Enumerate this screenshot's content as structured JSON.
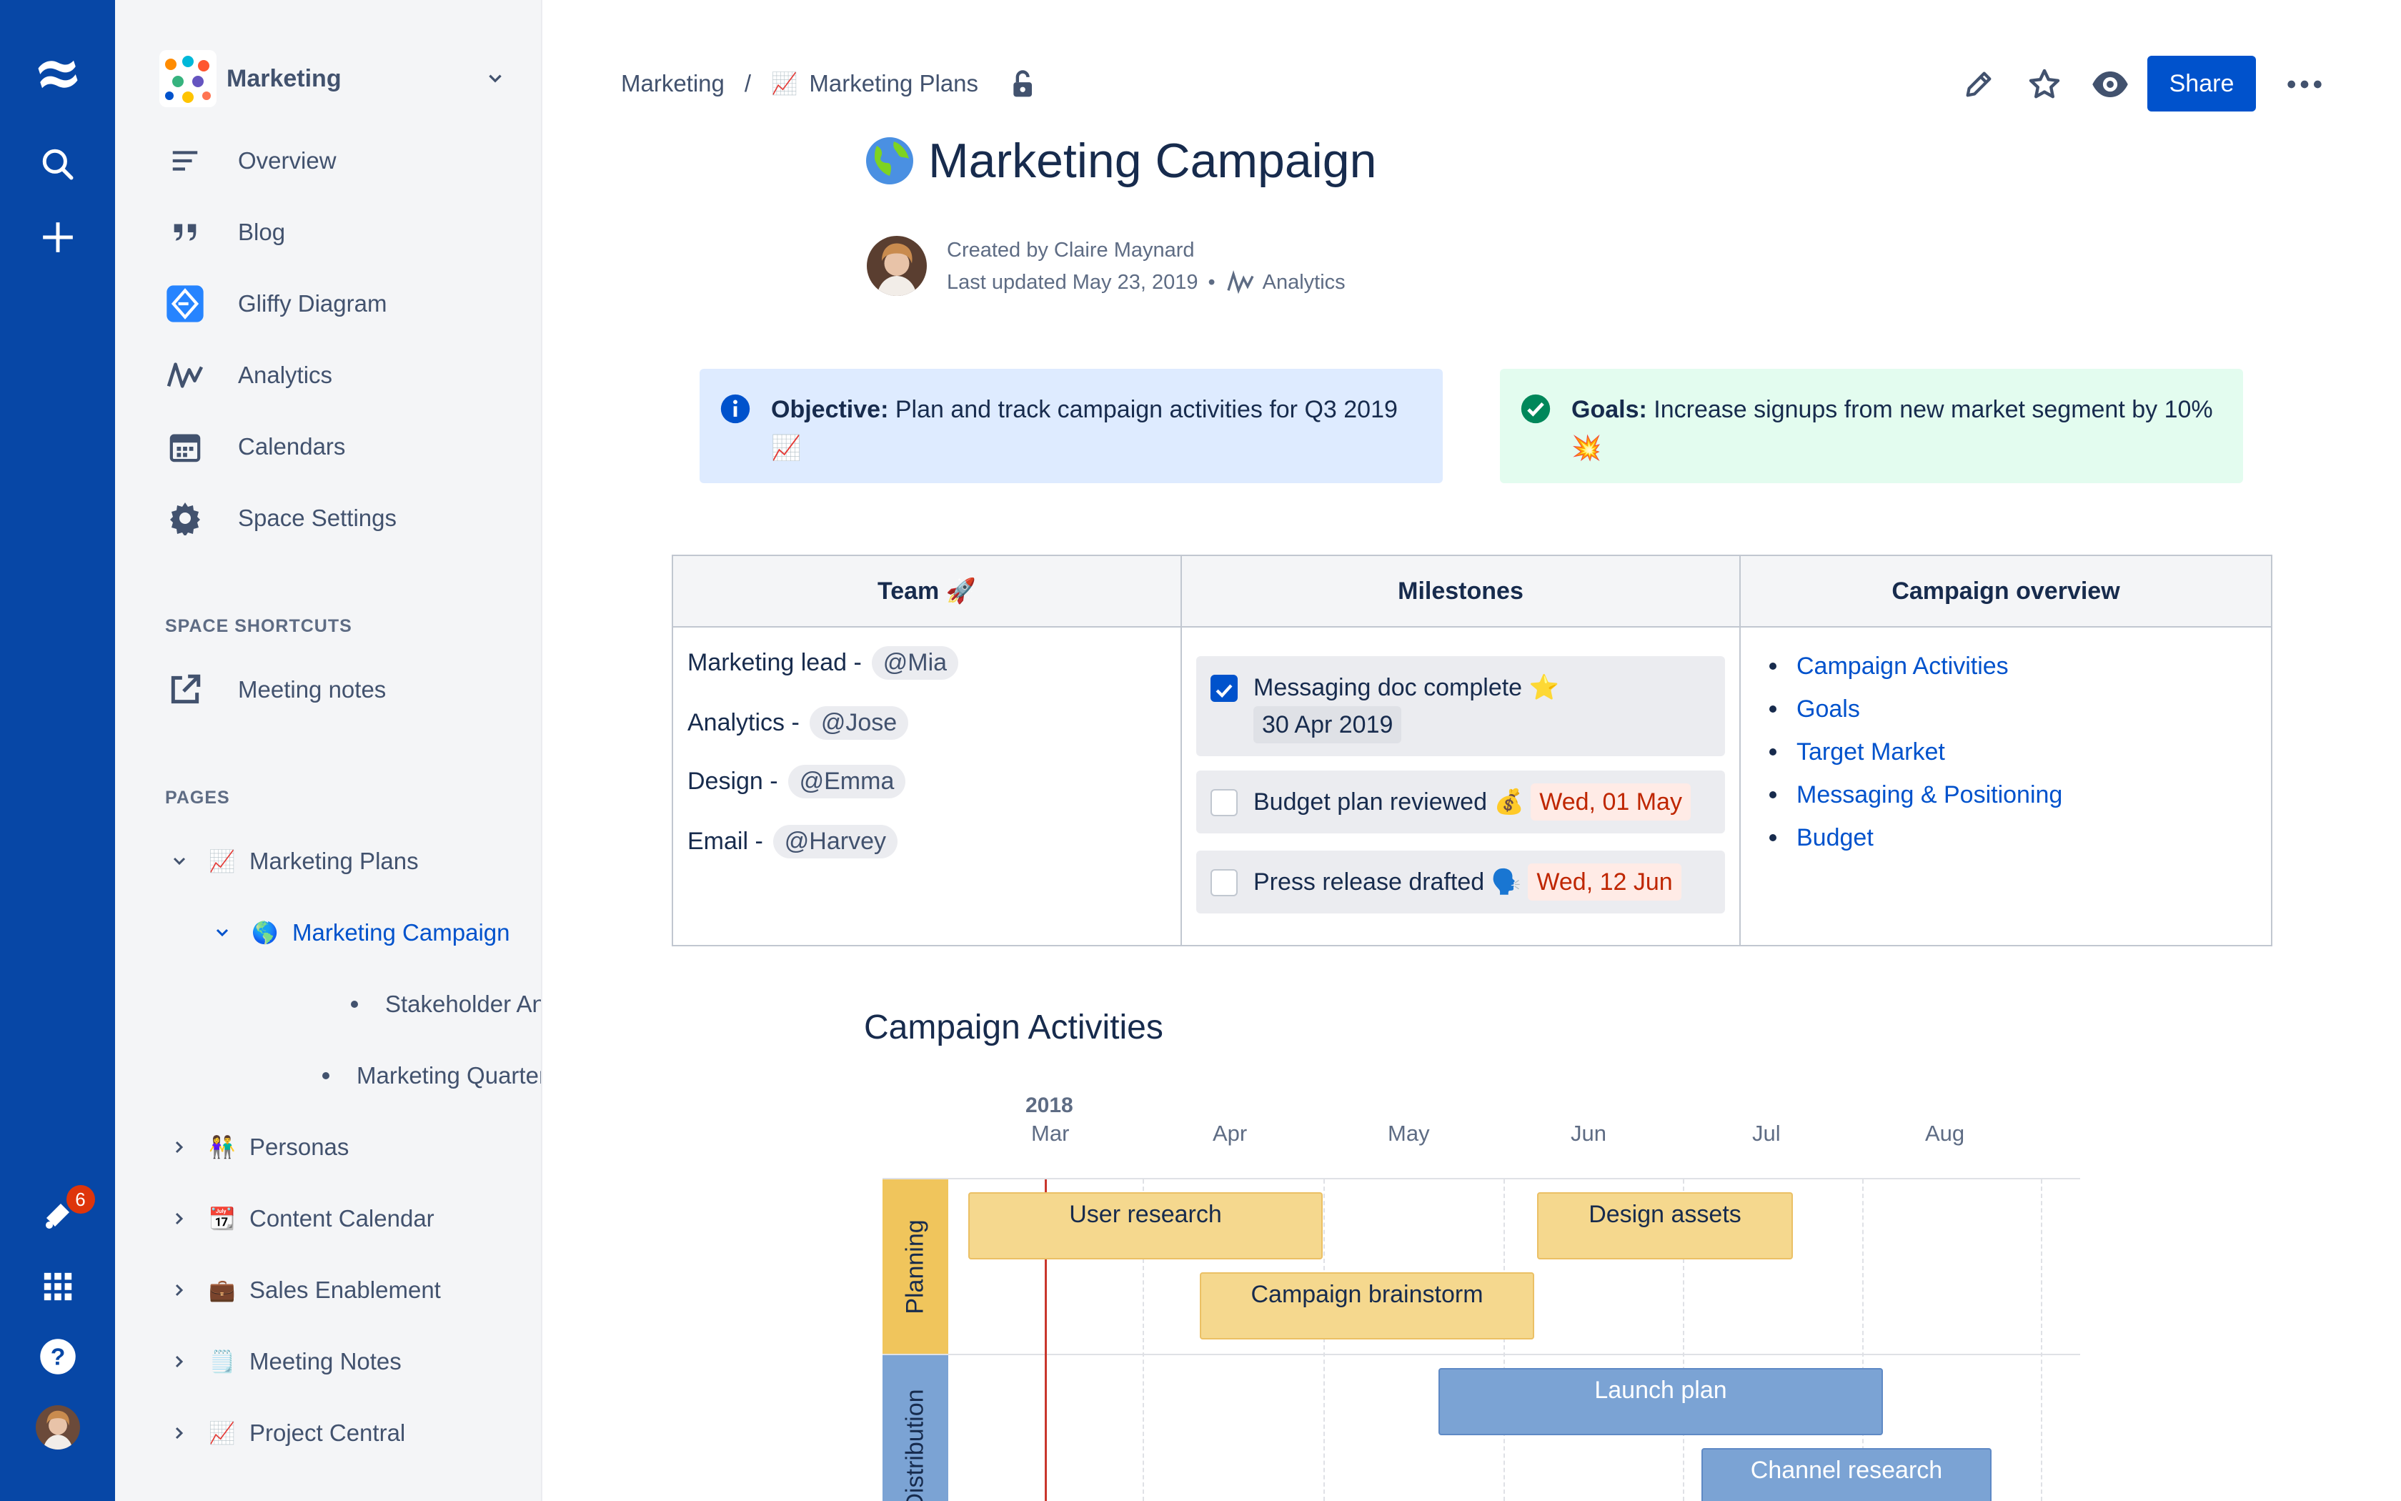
{
  "global_nav": {
    "notifications_count": "6",
    "icons": [
      "confluence-logo-icon",
      "search-icon",
      "create-icon",
      "notifications-icon",
      "app-switcher-icon",
      "help-icon",
      "profile-avatar"
    ]
  },
  "sidebar": {
    "space_name": "Marketing",
    "items": [
      {
        "label": "Overview",
        "icon": "overview-icon"
      },
      {
        "label": "Blog",
        "icon": "quote-icon"
      },
      {
        "label": "Gliffy Diagram",
        "icon": "gliffy-icon"
      },
      {
        "label": "Analytics",
        "icon": "analytics-icon"
      },
      {
        "label": "Calendars",
        "icon": "calendar-icon"
      },
      {
        "label": "Space Settings",
        "icon": "gear-icon"
      }
    ],
    "shortcuts_heading": "SPACE SHORTCUTS",
    "shortcuts": [
      {
        "label": "Meeting notes",
        "icon": "external-link-icon"
      }
    ],
    "pages_heading": "PAGES",
    "pages": [
      {
        "label": "Marketing Plans",
        "emoji": "📈"
      },
      {
        "label": "Marketing Campaign",
        "emoji": "🌎"
      },
      {
        "label": "Stakeholder Analysis S"
      },
      {
        "label": "Marketing Quarterly Plann"
      },
      {
        "label": "Personas",
        "emoji": "👫"
      },
      {
        "label": "Content Calendar",
        "emoji": "📆"
      },
      {
        "label": "Sales Enablement",
        "emoji": "💼"
      },
      {
        "label": "Meeting Notes",
        "emoji": "🗒️"
      },
      {
        "label": "Project Central",
        "emoji": "📈"
      }
    ]
  },
  "header": {
    "breadcrumb_space": "Marketing",
    "breadcrumb_separator": "/",
    "breadcrumb_page_emoji": "📈",
    "breadcrumb_page": "Marketing Plans",
    "share_label": "Share"
  },
  "page": {
    "title": "Marketing Campaign",
    "created_by": "Created by Claire Maynard",
    "last_updated": "Last updated May 23, 2019",
    "meta_dot": "•",
    "meta_link": "Analytics",
    "objective_label": "Objective:",
    "objective_text": "Plan and track campaign activities for Q3 2019",
    "objective_emoji": "📈",
    "goals_label": "Goals:",
    "goals_text": "Increase signups from new market segment by 10%",
    "goals_emoji": "💥"
  },
  "table": {
    "headers": {
      "team": "Team",
      "team_emoji": "🚀",
      "milestones": "Milestones",
      "overview": "Campaign overview"
    },
    "team": [
      {
        "role": "Marketing lead -",
        "mention": "@Mia"
      },
      {
        "role": "Analytics -",
        "mention": "@Jose"
      },
      {
        "role": "Design -",
        "mention": "@Emma"
      },
      {
        "role": "Email -",
        "mention": "@Harvey"
      }
    ],
    "milestones": [
      {
        "text": "Messaging doc complete",
        "emoji": "⭐",
        "date": "30 Apr 2019",
        "checked": true
      },
      {
        "text": "Budget plan reviewed",
        "emoji": "💰",
        "date": "Wed, 01 May",
        "checked": false
      },
      {
        "text": "Press release drafted",
        "emoji": "🗣️",
        "date": "Wed, 12 Jun",
        "checked": false
      }
    ],
    "overview_links": [
      "Campaign Activities",
      "Goals",
      "Target Market",
      "Messaging & Positioning",
      "Budget"
    ]
  },
  "timeline": {
    "heading": "Campaign Activities",
    "year": "2018",
    "months": [
      "Mar",
      "Apr",
      "May",
      "Jun",
      "Jul",
      "Aug"
    ],
    "lanes": [
      {
        "name": "Planning",
        "color": "#F0C55C"
      },
      {
        "name": "Distribution",
        "color": "#7BA3D4"
      }
    ],
    "bars": [
      {
        "label": "User research",
        "lane": "Planning"
      },
      {
        "label": "Campaign brainstorm",
        "lane": "Planning"
      },
      {
        "label": "Design assets",
        "lane": "Planning"
      },
      {
        "label": "Launch plan",
        "lane": "Distribution"
      },
      {
        "label": "Channel research",
        "lane": "Distribution"
      }
    ]
  },
  "colors": {
    "nav": "#0747A6",
    "accent": "#0052CC",
    "info_panel": "#DEEBFF",
    "success_panel": "#E3FCEF"
  }
}
